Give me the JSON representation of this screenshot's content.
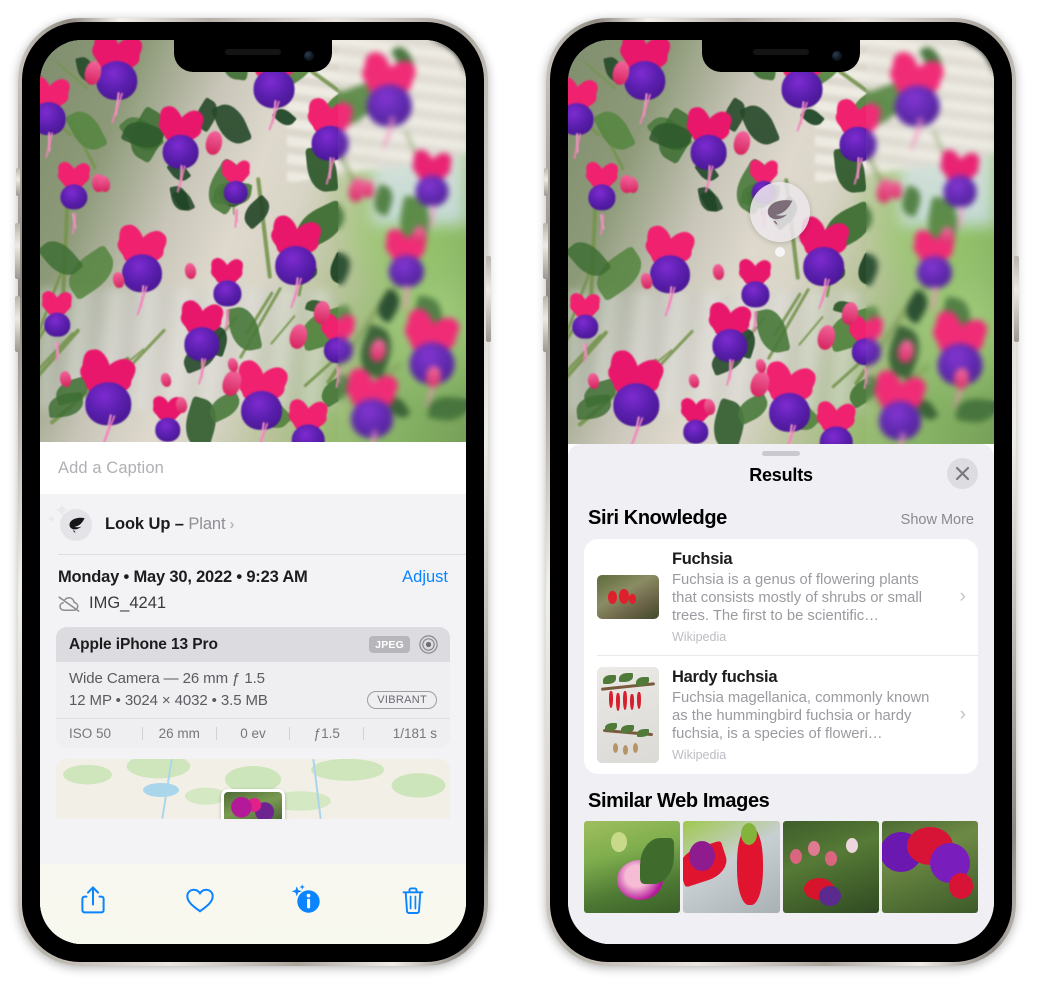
{
  "left_phone": {
    "caption_placeholder": "Add a Caption",
    "lookup": {
      "icon": "leaf-icon",
      "label": "Look Up – ",
      "subject": "Plant",
      "chevron": "›"
    },
    "meta": {
      "date": "Monday • May 30, 2022 • 9:23 AM",
      "adjust_label": "Adjust",
      "cloud_icon": "cloud-slash-icon",
      "filename": "IMG_4241"
    },
    "exif": {
      "device": "Apple iPhone 13 Pro",
      "format_tag": "JPEG",
      "lens_icon": "aperture-icon",
      "lens_line": "Wide Camera — 26 mm ƒ 1.5",
      "size_line": "12 MP • 3024 × 4032 • 3.5 MB",
      "style_tag": "VIBRANT",
      "stats": [
        "ISO 50",
        "26 mm",
        "0 ev",
        "ƒ1.5",
        "1/181 s"
      ]
    },
    "toolbar": [
      {
        "name": "share-button",
        "icon": "share-icon"
      },
      {
        "name": "favorite-button",
        "icon": "heart-icon"
      },
      {
        "name": "info-button",
        "icon": "info-sparkle-icon"
      },
      {
        "name": "delete-button",
        "icon": "trash-icon"
      }
    ]
  },
  "right_phone": {
    "visual_lookup_badge": {
      "icon": "leaf-icon"
    },
    "sheet": {
      "title": "Results",
      "close_icon": "close-icon",
      "siri_section": {
        "title": "Siri Knowledge",
        "show_more": "Show More",
        "items": [
          {
            "name": "Fuchsia",
            "description": "Fuchsia is a genus of flowering plants that consists mostly of shrubs or small trees. The first to be scientific…",
            "source": "Wikipedia",
            "chevron": "›"
          },
          {
            "name": "Hardy fuchsia",
            "description": "Fuchsia magellanica, commonly known as the hummingbird fuchsia or hardy fuchsia, is a species of floweri…",
            "source": "Wikipedia",
            "chevron": "›"
          }
        ]
      },
      "similar_section": {
        "title": "Similar Web Images",
        "images": [
          "fuchsia-web-image-1",
          "fuchsia-web-image-2",
          "fuchsia-web-image-3",
          "fuchsia-web-image-4"
        ]
      }
    }
  },
  "colors": {
    "accent_blue": "#0a84ff",
    "sheet_bg": "#f0eff4",
    "info_bg": "#f3f3f6",
    "toolbar_bg": "#f8f8f0",
    "secondary_text": "#8e8e93"
  }
}
